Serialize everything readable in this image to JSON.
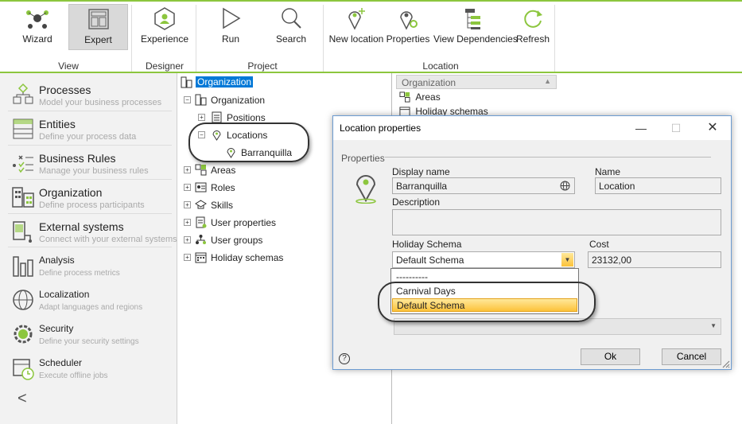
{
  "ribbon": {
    "groups": [
      {
        "label": "View"
      },
      {
        "label": "Designer"
      },
      {
        "label": "Project"
      },
      {
        "label": "Location"
      }
    ],
    "buttons": {
      "wizard": "Wizard",
      "expert": "Expert",
      "experience": "Experience",
      "run": "Run",
      "search": "Search",
      "new_location": "New location",
      "properties": "Properties",
      "view_dependencies": "View Dependencies",
      "refresh": "Refresh"
    }
  },
  "nav": [
    {
      "title": "Processes",
      "subtitle": "Model your business processes"
    },
    {
      "title": "Entities",
      "subtitle": "Define your process data"
    },
    {
      "title": "Business Rules",
      "subtitle": "Manage your business rules"
    },
    {
      "title": "Organization",
      "subtitle": "Define process participants"
    },
    {
      "title": "External systems",
      "subtitle": "Connect with your external systems"
    },
    {
      "title": "Analysis",
      "subtitle": "Define process metrics"
    },
    {
      "title": "Localization",
      "subtitle": "Adapt languages and regions"
    },
    {
      "title": "Security",
      "subtitle": "Define your security settings"
    },
    {
      "title": "Scheduler",
      "subtitle": "Execute offline jobs"
    }
  ],
  "nav_collapse_glyph": "<",
  "tree": {
    "root": "Organization",
    "nodes": [
      "Organization",
      "Positions",
      "Locations",
      "Barranquilla",
      "Areas",
      "Roles",
      "Skills",
      "User properties",
      "User groups",
      "Holiday schemas"
    ]
  },
  "list": {
    "column": "Organization",
    "items": [
      "Areas",
      "Holiday schemas"
    ]
  },
  "dialog": {
    "title": "Location properties",
    "section": "Properties",
    "display_name_label": "Display name",
    "display_name_value": "Barranquilla",
    "name_label": "Name",
    "name_value": "Location",
    "description_label": "Description",
    "description_value": "",
    "holiday_schema_label": "Holiday Schema",
    "holiday_schema_value": "Default Schema",
    "cost_label": "Cost",
    "cost_value": "23132,00",
    "dropdown_options": [
      "----------",
      "Carnival Days",
      "Default Schema"
    ],
    "ok": "Ok",
    "cancel": "Cancel",
    "help": "?"
  },
  "colors": {
    "accent_green": "#8cc63e",
    "selection_blue": "#0078d7",
    "highlight_orange": "#fcc23a"
  }
}
